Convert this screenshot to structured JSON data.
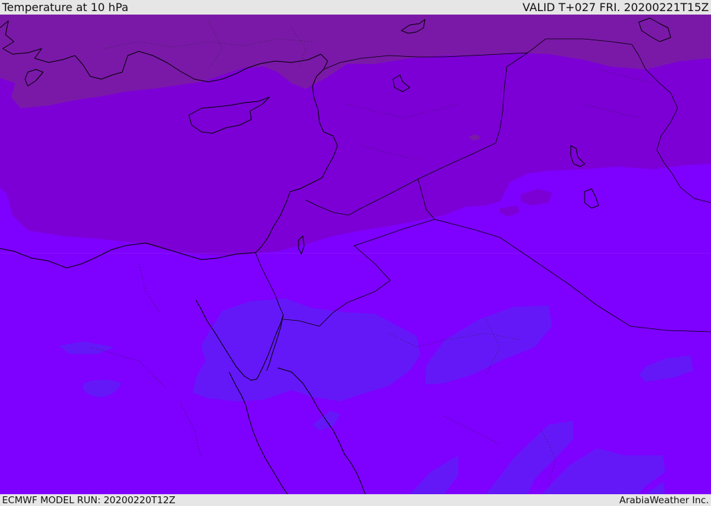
{
  "header": {
    "title": "Temperature at 10 hPa",
    "valid": "VALID T+027 FRI. 20200221T15Z"
  },
  "footer": {
    "model_run": "ECMWF MODEL RUN: 20200220T12Z",
    "credit": "ArabiaWeather Inc."
  },
  "colors": {
    "warmest": "#7a19a8",
    "warm": "#7c00d6",
    "base": "#7e00fe",
    "cool": "#6418f8",
    "bar_background": "#e6e6e6"
  }
}
